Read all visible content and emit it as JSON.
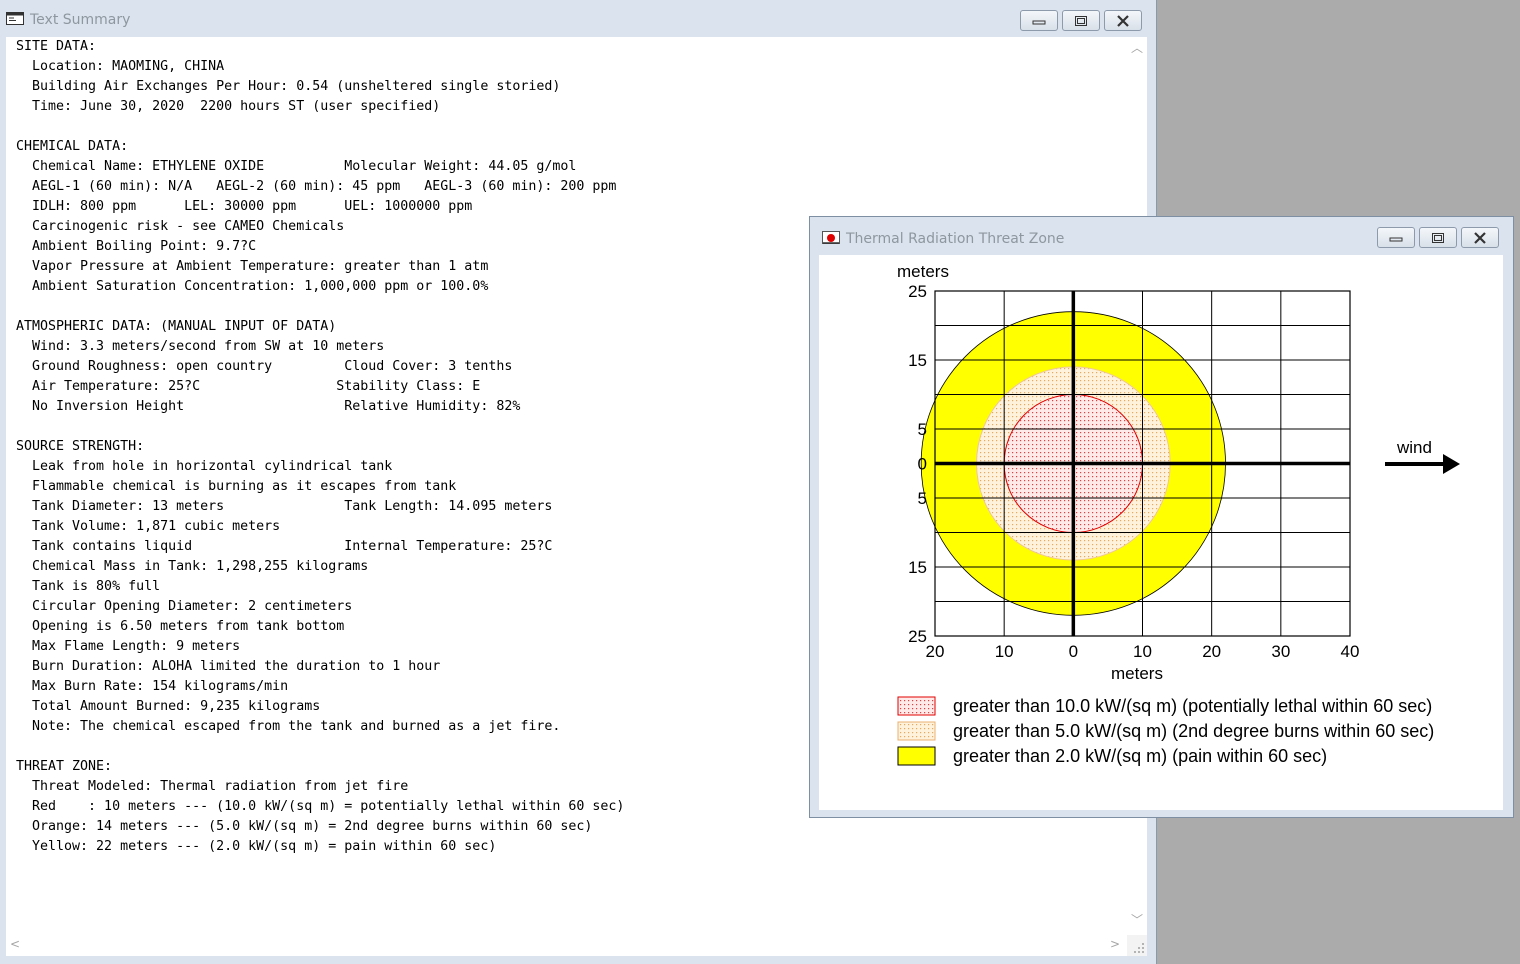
{
  "summary_window": {
    "title": "Text Summary",
    "lines": [
      "SITE DATA:",
      "  Location: MAOMING, CHINA",
      "  Building Air Exchanges Per Hour: 0.54 (unsheltered single storied)",
      "  Time: June 30, 2020  2200 hours ST (user specified)",
      "",
      "CHEMICAL DATA:",
      "  Chemical Name: ETHYLENE OXIDE          Molecular Weight: 44.05 g/mol",
      "  AEGL-1 (60 min): N/A   AEGL-2 (60 min): 45 ppm   AEGL-3 (60 min): 200 ppm",
      "  IDLH: 800 ppm      LEL: 30000 ppm      UEL: 1000000 ppm",
      "  Carcinogenic risk - see CAMEO Chemicals",
      "  Ambient Boiling Point: 9.7?C",
      "  Vapor Pressure at Ambient Temperature: greater than 1 atm",
      "  Ambient Saturation Concentration: 1,000,000 ppm or 100.0%",
      "",
      "ATMOSPHERIC DATA: (MANUAL INPUT OF DATA)",
      "  Wind: 3.3 meters/second from SW at 10 meters",
      "  Ground Roughness: open country         Cloud Cover: 3 tenths",
      "  Air Temperature: 25?C                 Stability Class: E",
      "  No Inversion Height                    Relative Humidity: 82%",
      "",
      "SOURCE STRENGTH:",
      "  Leak from hole in horizontal cylindrical tank",
      "  Flammable chemical is burning as it escapes from tank",
      "  Tank Diameter: 13 meters               Tank Length: 14.095 meters",
      "  Tank Volume: 1,871 cubic meters",
      "  Tank contains liquid                   Internal Temperature: 25?C",
      "  Chemical Mass in Tank: 1,298,255 kilograms",
      "  Tank is 80% full",
      "  Circular Opening Diameter: 2 centimeters",
      "  Opening is 6.50 meters from tank bottom",
      "  Max Flame Length: 9 meters",
      "  Burn Duration: ALOHA limited the duration to 1 hour",
      "  Max Burn Rate: 154 kilograms/min",
      "  Total Amount Burned: 9,235 kilograms",
      "  Note: The chemical escaped from the tank and burned as a jet fire.",
      "",
      "THREAT ZONE:",
      "  Threat Modeled: Thermal radiation from jet fire",
      "  Red    : 10 meters --- (10.0 kW/(sq m) = potentially lethal within 60 sec)",
      "  Orange: 14 meters --- (5.0 kW/(sq m) = 2nd degree burns within 60 sec)",
      "  Yellow: 22 meters --- (2.0 kW/(sq m) = pain within 60 sec)"
    ]
  },
  "threat_window": {
    "title": "Thermal Radiation Threat Zone",
    "wind_label": "wind"
  },
  "chart_data": {
    "type": "threat-zone-map",
    "ylabel": "meters",
    "xlabel": "meters",
    "x_tick_labels": [
      "20",
      "10",
      "0",
      "10",
      "20",
      "30",
      "40"
    ],
    "x_tick_values": [
      -20,
      -10,
      0,
      10,
      20,
      30,
      40
    ],
    "y_tick_labels": [
      "25",
      "15",
      "5",
      "0",
      "5",
      "15",
      "25"
    ],
    "y_tick_values": [
      25,
      15,
      5,
      0,
      -5,
      -15,
      -25
    ],
    "xlim": [
      -20,
      40
    ],
    "ylim": [
      -25,
      25
    ],
    "grid_x": [
      -20,
      -10,
      0,
      10,
      20,
      30,
      40
    ],
    "grid_y": [
      25,
      20,
      15,
      10,
      5,
      0,
      -5,
      -10,
      -15,
      -20,
      -25
    ],
    "zones": [
      {
        "radius_m": 22,
        "color": "#ffff00",
        "label": "greater than 2.0 kW/(sq m) (pain within 60 sec)"
      },
      {
        "radius_m": 14,
        "color": "#fcdcae",
        "label": "greater than 5.0 kW/(sq m) (2nd degree burns within 60 sec)"
      },
      {
        "radius_m": 10,
        "color": "#ffd8d8",
        "label": "greater than 10.0 kW/(sq m) (potentially lethal within 60 sec)"
      }
    ],
    "legend": [
      {
        "label": "greater than 10.0 kW/(sq m) (potentially lethal within 60 sec)",
        "color": "#ffd8d8",
        "border": "#e00000"
      },
      {
        "label": "greater than 5.0 kW/(sq m) (2nd degree burns within 60 sec)",
        "color": "#fcdcae",
        "border": "#e8b070"
      },
      {
        "label": "greater than 2.0 kW/(sq m) (pain within 60 sec)",
        "color": "#ffff00",
        "border": "#000000"
      }
    ],
    "legend_position": "bottom"
  }
}
